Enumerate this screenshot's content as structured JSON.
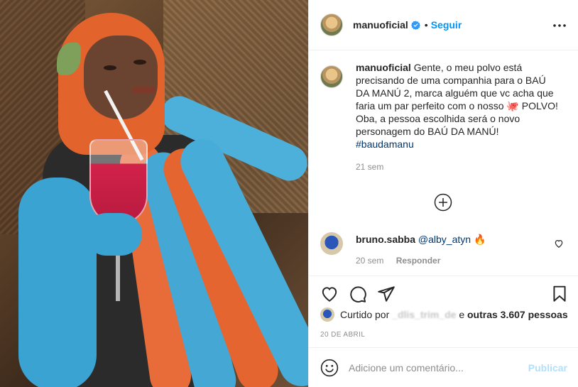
{
  "header": {
    "username": "manuoficial",
    "separator": "•",
    "follow_label": "Seguir",
    "more_icon": "more-options-icon"
  },
  "caption": {
    "username": "manuoficial",
    "text": "Gente, o meu polvo está precisando de uma companhia para o BAÚ DA MANÚ 2, marca alguém que vc acha que faria um par perfeito com o nosso 🐙 POLVO! Oba, a pessoa escolhida será o novo personagem do BAÚ DA MANÚ!",
    "hashtag": "#baudamanu",
    "time": "21 sem"
  },
  "comment": {
    "username": "bruno.sabba",
    "mention": "@alby_atyn",
    "emoji": "🔥",
    "time": "20 sem",
    "reply_label": "Responder"
  },
  "likes": {
    "prefix": "Curtido por",
    "user": "_dlis_trim_de",
    "connector": "e",
    "others": "outras 3.607 pessoas"
  },
  "date": "20 DE ABRIL",
  "add_comment": {
    "placeholder": "Adicione um comentário...",
    "publish_label": "Publicar"
  },
  "colors": {
    "accent": "#0095f6",
    "publish_disabled": "#b2dffc",
    "link": "#00376b",
    "muted": "#8e8e8e"
  }
}
